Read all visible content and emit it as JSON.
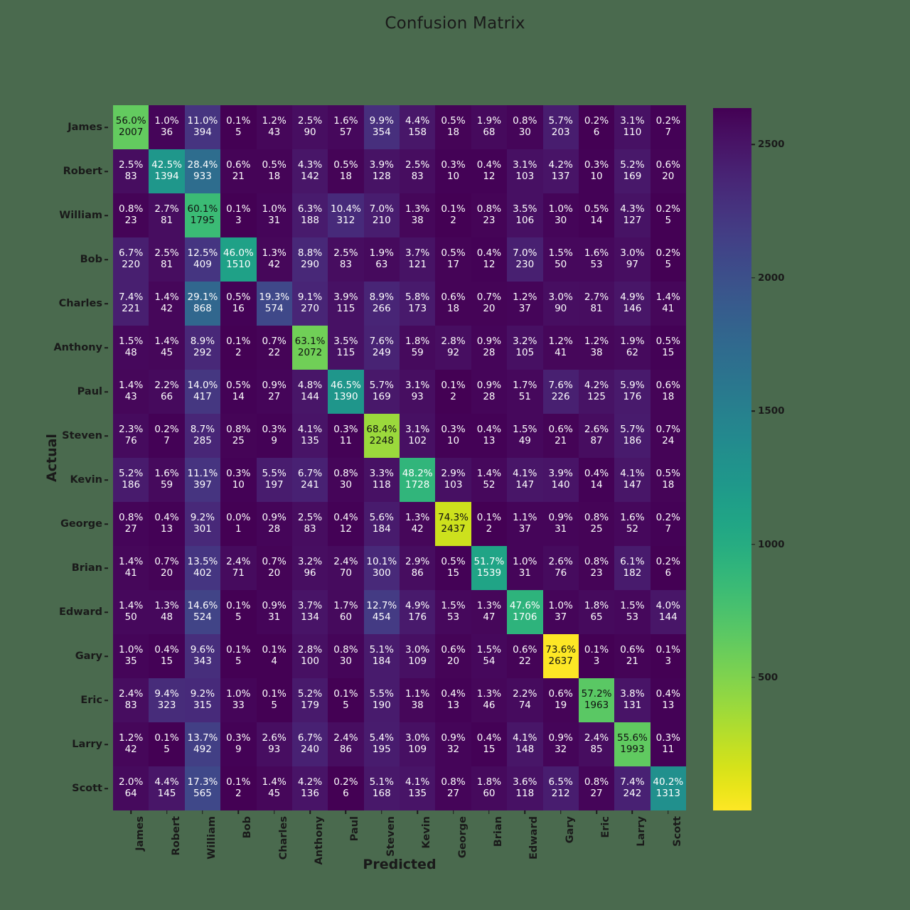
{
  "figure": {
    "title": "Confusion Matrix",
    "background_color": "#4a6a4e",
    "text_color": "#1a1a1a"
  },
  "axes": {
    "xlabel": "Predicted",
    "ylabel": "Actual"
  },
  "colorbar": {
    "ticks": [
      "500",
      "1000",
      "1500",
      "2000",
      "2500"
    ],
    "tick_values": [
      500,
      1000,
      1500,
      2000,
      2500
    ],
    "vmin": 1,
    "vmax": 2637,
    "colormap": "viridis"
  },
  "chart_data": {
    "type": "heatmap",
    "title": "Confusion Matrix",
    "xlabel": "Predicted",
    "ylabel": "Actual",
    "colormap": "viridis",
    "cbar_range": [
      1,
      2637
    ],
    "cbar_ticks": [
      500,
      1000,
      1500,
      2000,
      2500
    ],
    "x_categories": [
      "James",
      "Robert",
      "William",
      "Bob",
      "Charles",
      "Anthony",
      "Paul",
      "Steven",
      "Kevin",
      "George",
      "Brian",
      "Edward",
      "Gary",
      "Eric",
      "Larry",
      "Scott"
    ],
    "y_categories": [
      "James",
      "Robert",
      "William",
      "Bob",
      "Charles",
      "Anthony",
      "Paul",
      "Steven",
      "Kevin",
      "George",
      "Brian",
      "Edward",
      "Gary",
      "Eric",
      "Larry",
      "Scott"
    ],
    "annotation_format": "percent_over_count",
    "counts": [
      [
        2007,
        36,
        394,
        5,
        43,
        90,
        57,
        354,
        158,
        18,
        68,
        30,
        203,
        6,
        110,
        7
      ],
      [
        83,
        1394,
        933,
        21,
        18,
        142,
        18,
        128,
        83,
        10,
        12,
        103,
        137,
        10,
        169,
        20
      ],
      [
        23,
        81,
        1795,
        3,
        31,
        188,
        312,
        210,
        38,
        2,
        23,
        106,
        30,
        14,
        127,
        5
      ],
      [
        220,
        81,
        409,
        1510,
        42,
        290,
        83,
        63,
        121,
        17,
        12,
        230,
        50,
        53,
        97,
        5
      ],
      [
        221,
        42,
        868,
        16,
        574,
        270,
        115,
        266,
        173,
        18,
        20,
        37,
        90,
        81,
        146,
        41
      ],
      [
        48,
        45,
        292,
        2,
        22,
        2072,
        115,
        249,
        59,
        92,
        28,
        105,
        41,
        38,
        62,
        15
      ],
      [
        43,
        66,
        417,
        14,
        27,
        144,
        1390,
        169,
        93,
        2,
        28,
        51,
        226,
        125,
        176,
        18
      ],
      [
        76,
        7,
        285,
        25,
        9,
        135,
        11,
        2248,
        102,
        10,
        13,
        49,
        21,
        87,
        186,
        24
      ],
      [
        186,
        59,
        397,
        10,
        197,
        241,
        30,
        118,
        1728,
        103,
        52,
        147,
        140,
        14,
        147,
        18
      ],
      [
        27,
        13,
        301,
        1,
        28,
        83,
        12,
        184,
        42,
        2437,
        2,
        37,
        31,
        25,
        52,
        7
      ],
      [
        41,
        20,
        402,
        71,
        20,
        96,
        70,
        300,
        86,
        15,
        1539,
        31,
        76,
        23,
        182,
        6
      ],
      [
        50,
        48,
        524,
        5,
        31,
        134,
        60,
        454,
        176,
        53,
        47,
        1706,
        37,
        65,
        53,
        144
      ],
      [
        35,
        15,
        343,
        5,
        4,
        100,
        30,
        184,
        109,
        20,
        54,
        22,
        2637,
        3,
        21,
        3
      ],
      [
        83,
        323,
        315,
        33,
        5,
        179,
        5,
        190,
        38,
        13,
        46,
        74,
        19,
        1963,
        131,
        13
      ],
      [
        42,
        5,
        492,
        9,
        93,
        240,
        86,
        195,
        109,
        32,
        15,
        148,
        32,
        85,
        1993,
        11
      ],
      [
        64,
        145,
        565,
        2,
        45,
        136,
        6,
        168,
        135,
        27,
        60,
        118,
        212,
        27,
        242,
        1313
      ]
    ],
    "percents": [
      [
        "56.0%",
        "1.0%",
        "11.0%",
        "0.1%",
        "1.2%",
        "2.5%",
        "1.6%",
        "9.9%",
        "4.4%",
        "0.5%",
        "1.9%",
        "0.8%",
        "5.7%",
        "0.2%",
        "3.1%",
        "0.2%"
      ],
      [
        "2.5%",
        "42.5%",
        "28.4%",
        "0.6%",
        "0.5%",
        "4.3%",
        "0.5%",
        "3.9%",
        "2.5%",
        "0.3%",
        "0.4%",
        "3.1%",
        "4.2%",
        "0.3%",
        "5.2%",
        "0.6%"
      ],
      [
        "0.8%",
        "2.7%",
        "60.1%",
        "0.1%",
        "1.0%",
        "6.3%",
        "10.4%",
        "7.0%",
        "1.3%",
        "0.1%",
        "0.8%",
        "3.5%",
        "1.0%",
        "0.5%",
        "4.3%",
        "0.2%"
      ],
      [
        "6.7%",
        "2.5%",
        "12.5%",
        "46.0%",
        "1.3%",
        "8.8%",
        "2.5%",
        "1.9%",
        "3.7%",
        "0.5%",
        "0.4%",
        "7.0%",
        "1.5%",
        "1.6%",
        "3.0%",
        "0.2%"
      ],
      [
        "7.4%",
        "1.4%",
        "29.1%",
        "0.5%",
        "19.3%",
        "9.1%",
        "3.9%",
        "8.9%",
        "5.8%",
        "0.6%",
        "0.7%",
        "1.2%",
        "3.0%",
        "2.7%",
        "4.9%",
        "1.4%"
      ],
      [
        "1.5%",
        "1.4%",
        "8.9%",
        "0.1%",
        "0.7%",
        "63.1%",
        "3.5%",
        "7.6%",
        "1.8%",
        "2.8%",
        "0.9%",
        "3.2%",
        "1.2%",
        "1.2%",
        "1.9%",
        "0.5%"
      ],
      [
        "1.4%",
        "2.2%",
        "14.0%",
        "0.5%",
        "0.9%",
        "4.8%",
        "46.5%",
        "5.7%",
        "3.1%",
        "0.1%",
        "0.9%",
        "1.7%",
        "7.6%",
        "4.2%",
        "5.9%",
        "0.6%"
      ],
      [
        "2.3%",
        "0.2%",
        "8.7%",
        "0.8%",
        "0.3%",
        "4.1%",
        "0.3%",
        "68.4%",
        "3.1%",
        "0.3%",
        "0.4%",
        "1.5%",
        "0.6%",
        "2.6%",
        "5.7%",
        "0.7%"
      ],
      [
        "5.2%",
        "1.6%",
        "11.1%",
        "0.3%",
        "5.5%",
        "6.7%",
        "0.8%",
        "3.3%",
        "48.2%",
        "2.9%",
        "1.4%",
        "4.1%",
        "3.9%",
        "0.4%",
        "4.1%",
        "0.5%"
      ],
      [
        "0.8%",
        "0.4%",
        "9.2%",
        "0.0%",
        "0.9%",
        "2.5%",
        "0.4%",
        "5.6%",
        "1.3%",
        "74.3%",
        "0.1%",
        "1.1%",
        "0.9%",
        "0.8%",
        "1.6%",
        "0.2%"
      ],
      [
        "1.4%",
        "0.7%",
        "13.5%",
        "2.4%",
        "0.7%",
        "3.2%",
        "2.4%",
        "10.1%",
        "2.9%",
        "0.5%",
        "51.7%",
        "1.0%",
        "2.6%",
        "0.8%",
        "6.1%",
        "0.2%"
      ],
      [
        "1.4%",
        "1.3%",
        "14.6%",
        "0.1%",
        "0.9%",
        "3.7%",
        "1.7%",
        "12.7%",
        "4.9%",
        "1.5%",
        "1.3%",
        "47.6%",
        "1.0%",
        "1.8%",
        "1.5%",
        "4.0%"
      ],
      [
        "1.0%",
        "0.4%",
        "9.6%",
        "0.1%",
        "0.1%",
        "2.8%",
        "0.8%",
        "5.1%",
        "3.0%",
        "0.6%",
        "1.5%",
        "0.6%",
        "73.6%",
        "0.1%",
        "0.6%",
        "0.1%"
      ],
      [
        "2.4%",
        "9.4%",
        "9.2%",
        "1.0%",
        "0.1%",
        "5.2%",
        "0.1%",
        "5.5%",
        "1.1%",
        "0.4%",
        "1.3%",
        "2.2%",
        "0.6%",
        "57.2%",
        "3.8%",
        "0.4%"
      ],
      [
        "1.2%",
        "0.1%",
        "13.7%",
        "0.3%",
        "2.6%",
        "6.7%",
        "2.4%",
        "5.4%",
        "3.0%",
        "0.9%",
        "0.4%",
        "4.1%",
        "0.9%",
        "2.4%",
        "55.6%",
        "0.3%"
      ],
      [
        "2.0%",
        "4.4%",
        "17.3%",
        "0.1%",
        "1.4%",
        "4.2%",
        "0.2%",
        "5.1%",
        "4.1%",
        "0.8%",
        "1.8%",
        "3.6%",
        "6.5%",
        "0.8%",
        "7.4%",
        "40.2%"
      ]
    ]
  }
}
